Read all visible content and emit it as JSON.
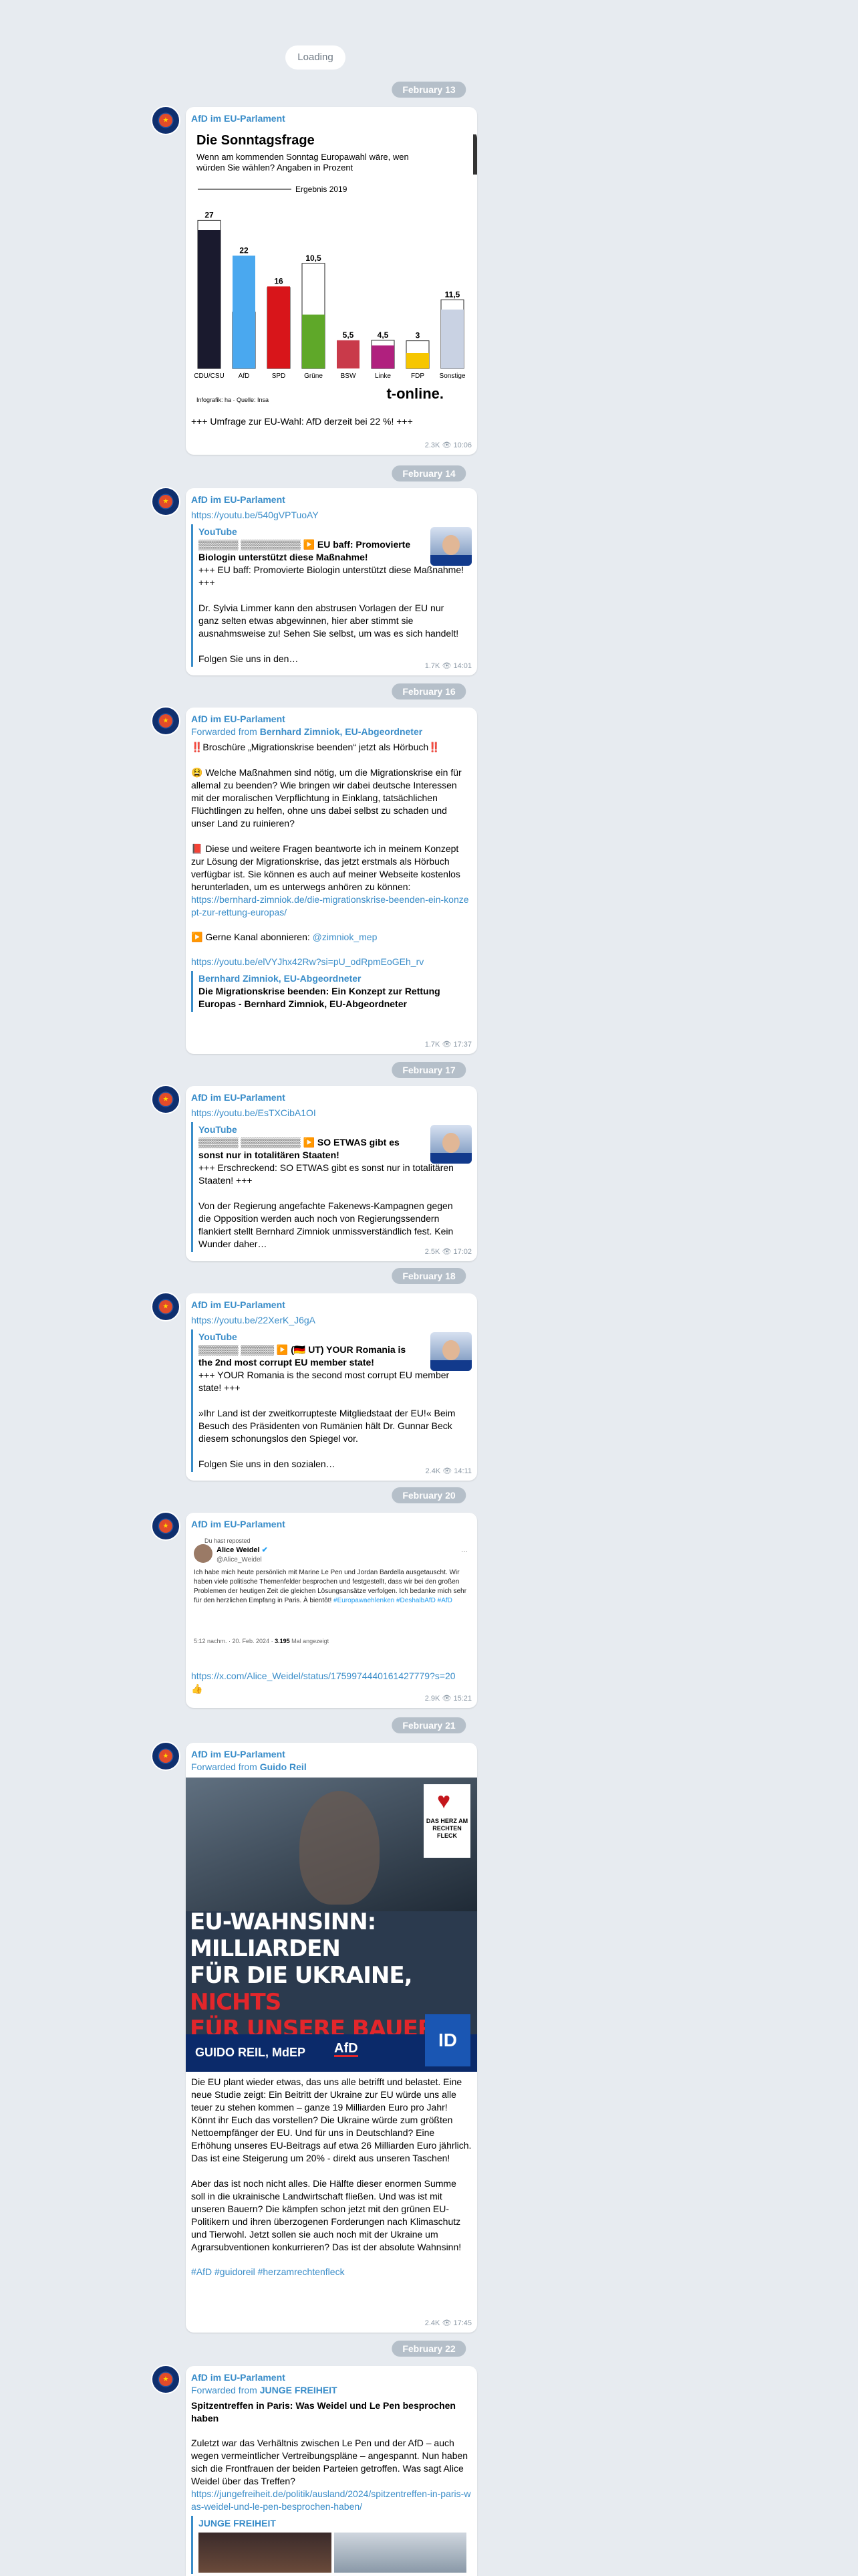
{
  "loading": "Loading",
  "dates": [
    "February 13",
    "February 14",
    "February 16",
    "February 17",
    "February 18",
    "February 20",
    "February 21",
    "February 22"
  ],
  "channel": "AfD im EU-Parlament",
  "msg1": {
    "chart_title": "Die Sonntagsfrage",
    "chart_subtitle": "Wenn am kommenden Sonntag Europawahl wäre, wen würden Sie wählen? Angaben in Prozent",
    "legend_2019": "Ergebnis 2019",
    "source": "Infografik: ha · Quelle: Insa",
    "brand": "t-online.",
    "text": "+++ Umfrage zur EU-Wahl: AfD derzeit bei 22 %! +++",
    "views": "2.3K",
    "time": "10:06",
    "chart_data": {
      "type": "bar",
      "categories": [
        "CDU/CSU",
        "AfD",
        "SPD",
        "Grüne",
        "BSW",
        "Linke",
        "FDP",
        "Sonstige"
      ],
      "values": [
        27,
        22,
        16,
        10.5,
        5.5,
        4.5,
        3,
        11.5
      ],
      "value_labels": [
        "27",
        "22",
        "16",
        "10,5",
        "5,5",
        "4,5",
        "3",
        "11,5"
      ],
      "colors": [
        "#1a1a2e",
        "#4aa8ef",
        "#d8151a",
        "#5fa829",
        "#c93a4a",
        "#b0207e",
        "#f6c600",
        "#c9d2e3"
      ],
      "results_2019": [
        28.9,
        11,
        15.8,
        20.5,
        0,
        5.5,
        5.4,
        13.4
      ],
      "ylim": [
        0,
        30
      ]
    }
  },
  "msg2": {
    "link": "https://youtu.be/540gVPTuoAY",
    "site": "YouTube",
    "title": "▒▒▒▒▒▒ ▒▒▒▒▒▒▒▒▒ ▶️ EU baff: Promovierte Biologin unterstützt diese Maßnahme!",
    "body": "+++ EU baff: Promovierte Biologin unterstützt diese Maßnahme! +++\n\nDr. Sylvia Limmer kann den abstrusen Vorlagen der EU nur ganz selten etwas abgewinnen, hier aber stimmt sie ausnahmsweise zu! Sehen Sie selbst, um was es sich handelt!\n\nFolgen Sie uns in den…",
    "views": "1.7K",
    "time": "14:01"
  },
  "msg3": {
    "fwd_prefix": "Forwarded from ",
    "fwd_from": "Bernhard Zimniok, EU-Abgeordneter",
    "text": "‼️Broschüre „Migrationskrise beenden“ jetzt als Hörbuch‼️\n\n😫 Welche Maßnahmen sind nötig, um die Migrationskrise ein für allemal zu beenden? Wie bringen wir dabei deutsche Interessen mit der moralischen Verpflichtung in Einklang, tatsächlichen Flüchtlingen zu helfen, ohne uns dabei selbst zu schaden und unser Land zu ruinieren?\n\n📕 Diese und weitere Fragen beantworte ich in meinem Konzept zur Lösung der Migrationskrise, das jetzt erstmals als Hörbuch verfügbar ist. Sie können es auch auf meiner Webseite kostenlos herunterladen, um es unterwegs anhören zu können:",
    "link1": "https://bernhard-zimniok.de/die-migrationskrise-beenden-ein-konzept-zur-rettung-europas/",
    "subscribe": "▶️ Gerne Kanal abonnieren: ",
    "handle": "@zimniok_mep",
    "link2": "https://youtu.be/elVYJhx42Rw?si=pU_odRpmEoGEh_rv",
    "preview_site": "Bernhard Zimniok, EU-Abgeordneter",
    "preview_title": "Die Migrationskrise beenden: Ein Konzept zur Rettung Europas - Bernhard Zimniok, EU-Abgeordneter",
    "views": "1.7K",
    "time": "17:37"
  },
  "msg4": {
    "link": "https://youtu.be/EsTXCibA1OI",
    "site": "YouTube",
    "title": "▒▒▒▒▒▒ ▒▒▒▒▒▒▒▒▒ ▶️ SO ETWAS gibt es sonst nur in totalitären Staaten!",
    "body": "+++ Erschreckend: SO ETWAS gibt es sonst nur in totalitären Staaten! +++\n\nVon der Regierung angefachte Fakenews-Kampagnen gegen die Opposition werden auch noch von Regierungssendern flankiert stellt Bernhard Zimniok unmissverständlich fest. Kein Wunder daher…",
    "views": "2.5K",
    "time": "17:02"
  },
  "msg5": {
    "link": "https://youtu.be/22XerK_J6gA",
    "site": "YouTube",
    "title": "▒▒▒▒▒▒ ▒▒▒▒▒ ▶️ (🇩🇪 UT) YOUR Romania is the 2nd most corrupt EU member state!",
    "body": "+++ YOUR Romania is the second most corrupt EU member state! +++\n\n»Ihr Land ist der zweitkorrupteste Mitgliedstaat der EU!« Beim Besuch des Präsidenten von Rumänien hält Dr. Gunnar Beck diesem schonungslos den Spiegel vor.\n\nFolgen Sie uns in den sozialen…",
    "views": "2.4K",
    "time": "14:11"
  },
  "msg6": {
    "reposted": "Du hast reposted",
    "author": "Alice Weidel",
    "handle": "@Alice_Weidel",
    "tweet": "Ich habe mich heute persönlich mit Marine Le Pen und Jordan Bardella ausgetauscht. Wir haben viele politische Themenfelder besprochen und festgestellt, dass wir bei den großen Problemen der heutigen Zeit die gleichen Lösungsansätze verfolgen. Ich bedanke mich sehr für den herzlichen Empfang in Paris. À bientôt! ",
    "hashtags": "#Europawaehlenken #DeshalbAfD #AfD",
    "tweet_meta": "5:12 nachm. · 20. Feb. 2024 · ",
    "tweet_views": "3.195",
    "tweet_views_label": " Mal angezeigt",
    "link": "https://x.com/Alice_Weidel/status/1759974440161427779?s=20",
    "emoji": "👍",
    "views": "2.9K",
    "time": "15:21"
  },
  "msg7": {
    "fwd_prefix": "Forwarded from ",
    "fwd_from": "Guido Reil",
    "badge": "DAS HERZ AM RECHTEN FLECK",
    "headline1": "EU-WAHNSINN: MILLIARDEN",
    "headline2": "FÜR DIE UKRAINE, ",
    "headline_red": "NICHTS",
    "headline3_red": "FÜR UNSERE BAUERN",
    "headline3_end": "!",
    "name_band": "GUIDO REIL, MdEP",
    "party": "AfD",
    "id_logo": "ID",
    "text": "Die EU plant wieder etwas, das uns alle betrifft und belastet. Eine neue Studie zeigt: Ein Beitritt der Ukraine zur EU würde uns alle teuer zu stehen kommen – ganze 19 Milliarden Euro pro Jahr! Könnt ihr Euch das vorstellen? Die Ukraine würde zum größten Nettoempfänger der EU. Und für uns in Deutschland? Eine Erhöhung unseres EU-Beitrags auf etwa 26 Milliarden Euro jährlich. Das ist eine Steigerung um 20% - direkt aus unseren Taschen!\n\nAber das ist noch nicht alles. Die Hälfte dieser enormen Summe soll in die ukrainische Landwirtschaft fließen. Und was ist mit unseren Bauern? Die kämpfen schon jetzt mit den grünen EU-Politikern und ihren überzogenen Forderungen nach Klimaschutz und Tierwohl. Jetzt sollen sie auch noch mit der Ukraine um Agrarsubventionen konkurrieren? Das ist der absolute Wahnsinn!",
    "tags": "#AfD #guidoreil #herzamrechtenfleck",
    "views": "2.4K",
    "time": "17:45"
  },
  "msg8": {
    "fwd_prefix": "Forwarded from ",
    "fwd_from": "JUNGE FREIHEIT",
    "title": "Spitzentreffen in Paris: Was Weidel und Le Pen besprochen haben",
    "text": "Zuletzt war das Verhältnis zwischen Le Pen und der AfD – auch wegen vermeintlicher Vertreibungspläne – angespannt. Nun haben sich die Frontfrauen der beiden Parteien getroffen. Was sagt Alice Weidel über das Treffen?",
    "link": "https://jungefreiheit.de/politik/ausland/2024/spitzentreffen-in-paris-was-weidel-und-le-pen-besprochen-haben/",
    "preview_site": "JUNGE FREIHEIT"
  }
}
